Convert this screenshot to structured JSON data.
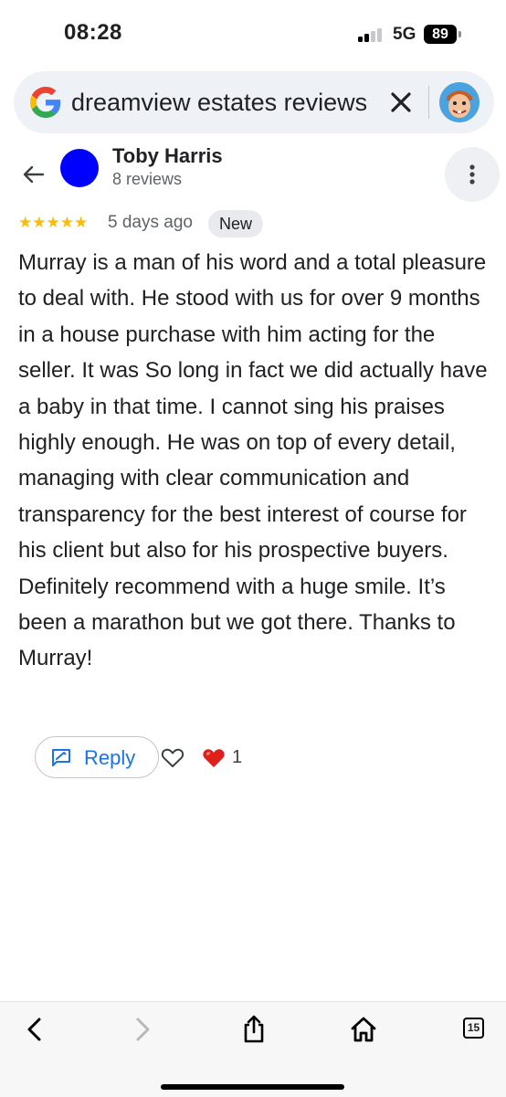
{
  "status_bar": {
    "time": "08:28",
    "network": "5G",
    "battery": "89"
  },
  "search": {
    "query": "dreamview estates reviews"
  },
  "review": {
    "reviewer_name": "Toby Harris",
    "reviewer_reviews": "8 reviews",
    "rating": 5,
    "stars": "★★★★★",
    "date": "5 days ago",
    "badge": "New",
    "text": "Murray is a man of his word and a total pleasure to deal with. He stood with us for over 9 months in a house purchase with him acting for the seller. It was So long in fact we did actually have a baby in that time. I cannot sing his praises highly enough. He was on top of every detail, managing with clear communication and transparency for the best interest of course for his client but also for his prospective buyers. Definitely recommend with a huge smile. It’s been a marathon but we got there. Thanks to Murray!",
    "reply_label": "Reply",
    "reaction_count": "1"
  },
  "toolbar": {
    "tabs_count": "15"
  },
  "colors": {
    "accent": "#1a73e8",
    "star": "#fbbc04",
    "avatar": "#0000ff",
    "heart": "#e0201b",
    "search_bg": "#eef2f6"
  },
  "icons": {
    "google": "google-logo-icon",
    "clear": "close-icon",
    "back": "arrow-left-icon",
    "more": "more-vert-icon",
    "reply": "reply-icon",
    "like": "heart-outline-icon",
    "reaction": "red-heart-icon",
    "browser_back": "chevron-left-icon",
    "browser_forward": "chevron-right-icon",
    "share": "share-icon",
    "home": "home-icon",
    "tabs": "tabs-icon"
  }
}
